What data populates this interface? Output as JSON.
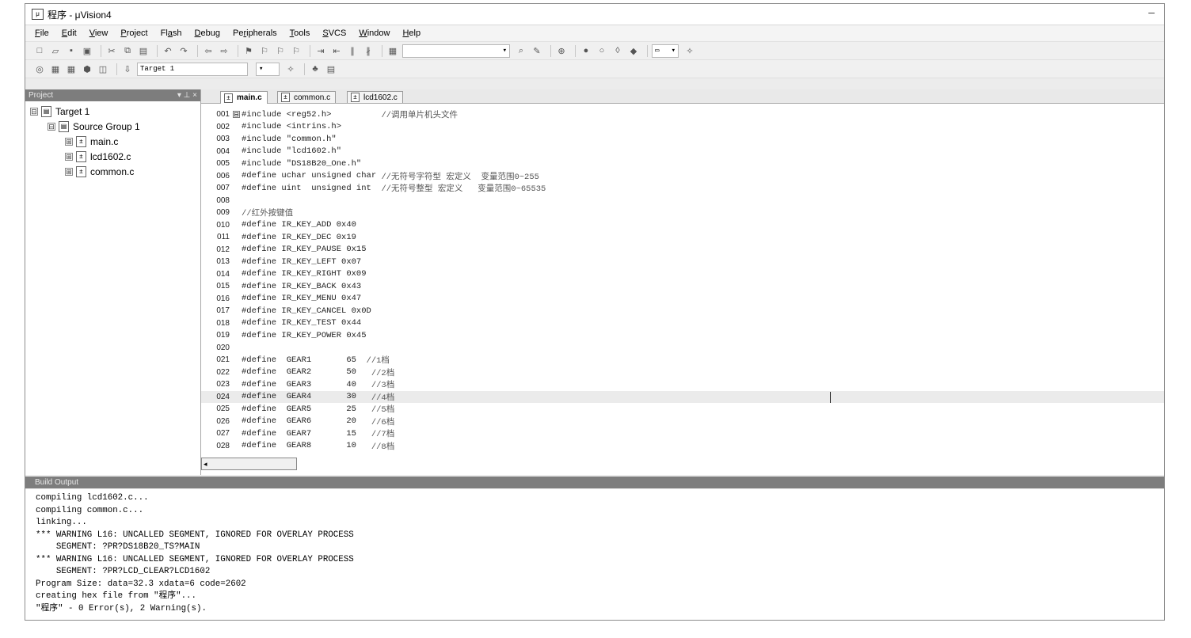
{
  "window": {
    "title": "程序 - μVision4",
    "app_icon": "uvision-icon",
    "minimize": "–"
  },
  "menu": [
    {
      "pre": "",
      "u": "F",
      "post": "ile"
    },
    {
      "pre": "",
      "u": "E",
      "post": "dit"
    },
    {
      "pre": "",
      "u": "V",
      "post": "iew"
    },
    {
      "pre": "",
      "u": "P",
      "post": "roject"
    },
    {
      "pre": "Fl",
      "u": "a",
      "post": "sh"
    },
    {
      "pre": "",
      "u": "D",
      "post": "ebug"
    },
    {
      "pre": "Pe",
      "u": "r",
      "post": "ipherals"
    },
    {
      "pre": "",
      "u": "T",
      "post": "ools"
    },
    {
      "pre": "",
      "u": "S",
      "post": "VCS"
    },
    {
      "pre": "",
      "u": "W",
      "post": "indow"
    },
    {
      "pre": "",
      "u": "H",
      "post": "elp"
    }
  ],
  "toolbar2": {
    "target_select": "Target 1"
  },
  "project_panel": {
    "title": "Project",
    "header_icons": "▾ ⊥ ×",
    "tree": [
      {
        "indent": 6,
        "toggle": "⊟",
        "icon": "target-folder-icon",
        "label": "Target 1"
      },
      {
        "indent": 28,
        "toggle": "⊟",
        "icon": "folder-icon",
        "label": "Source Group 1"
      },
      {
        "indent": 50,
        "toggle": "⊞",
        "icon": "c-file-icon",
        "label": "main.c"
      },
      {
        "indent": 50,
        "toggle": "⊞",
        "icon": "c-file-icon",
        "label": "lcd1602.c"
      },
      {
        "indent": 50,
        "toggle": "⊞",
        "icon": "c-file-icon",
        "label": "common.c"
      }
    ]
  },
  "editor": {
    "tabs": [
      {
        "label": "main.c",
        "active": true
      },
      {
        "label": "common.c",
        "active": false
      },
      {
        "label": "lcd1602.c",
        "active": false
      }
    ],
    "lines": [
      {
        "n": "001",
        "code": "#include <reg52.h>          ",
        "cmt": "//调用单片机头文件",
        "fold": "⊟"
      },
      {
        "n": "002",
        "code": "#include <intrins.h>",
        "cmt": ""
      },
      {
        "n": "003",
        "code": "#include \"common.h\"",
        "cmt": ""
      },
      {
        "n": "004",
        "code": "#include \"lcd1602.h\"",
        "cmt": ""
      },
      {
        "n": "005",
        "code": "#include \"DS18B20_One.h\"",
        "cmt": ""
      },
      {
        "n": "006",
        "code": "#define uchar unsigned char ",
        "cmt": "//无符号字符型 宏定义  变量范围0~255"
      },
      {
        "n": "007",
        "code": "#define uint  unsigned int  ",
        "cmt": "//无符号整型 宏定义   变量范围0~65535"
      },
      {
        "n": "008",
        "code": "",
        "cmt": ""
      },
      {
        "n": "009",
        "code": "",
        "cmt": "//红外按键值"
      },
      {
        "n": "010",
        "code": "#define IR_KEY_ADD 0x40",
        "cmt": ""
      },
      {
        "n": "011",
        "code": "#define IR_KEY_DEC 0x19",
        "cmt": ""
      },
      {
        "n": "012",
        "code": "#define IR_KEY_PAUSE 0x15",
        "cmt": ""
      },
      {
        "n": "013",
        "code": "#define IR_KEY_LEFT 0x07",
        "cmt": ""
      },
      {
        "n": "014",
        "code": "#define IR_KEY_RIGHT 0x09",
        "cmt": ""
      },
      {
        "n": "015",
        "code": "#define IR_KEY_BACK 0x43",
        "cmt": ""
      },
      {
        "n": "016",
        "code": "#define IR_KEY_MENU 0x47",
        "cmt": ""
      },
      {
        "n": "017",
        "code": "#define IR_KEY_CANCEL 0x0D",
        "cmt": ""
      },
      {
        "n": "018",
        "code": "#define IR_KEY_TEST 0x44",
        "cmt": ""
      },
      {
        "n": "019",
        "code": "#define IR_KEY_POWER 0x45",
        "cmt": ""
      },
      {
        "n": "020",
        "code": "",
        "cmt": ""
      },
      {
        "n": "021",
        "code": "#define  GEAR1       65  ",
        "cmt": "//1档"
      },
      {
        "n": "022",
        "code": "#define  GEAR2       50   ",
        "cmt": "//2档"
      },
      {
        "n": "023",
        "code": "#define  GEAR3       40   ",
        "cmt": "//3档"
      },
      {
        "n": "024",
        "code": "#define  GEAR4       30   ",
        "cmt": "//4档",
        "current": true
      },
      {
        "n": "025",
        "code": "#define  GEAR5       25   ",
        "cmt": "//5档"
      },
      {
        "n": "026",
        "code": "#define  GEAR6       20   ",
        "cmt": "//6档"
      },
      {
        "n": "027",
        "code": "#define  GEAR7       15   ",
        "cmt": "//7档"
      },
      {
        "n": "028",
        "code": "#define  GEAR8       10   ",
        "cmt": "//8档"
      }
    ],
    "hscroll_left": "◂"
  },
  "build": {
    "title": "Build Output",
    "lines": [
      "compiling lcd1602.c...",
      "compiling common.c...",
      "linking...",
      "*** WARNING L16: UNCALLED SEGMENT, IGNORED FOR OVERLAY PROCESS",
      "    SEGMENT: ?PR?DS18B20_TS?MAIN",
      "*** WARNING L16: UNCALLED SEGMENT, IGNORED FOR OVERLAY PROCESS",
      "    SEGMENT: ?PR?LCD_CLEAR?LCD1602",
      "Program Size: data=32.3 xdata=6 code=2602",
      "creating hex file from \"程序\"...",
      "\"程序\" - 0 Error(s), 2 Warning(s)."
    ]
  }
}
